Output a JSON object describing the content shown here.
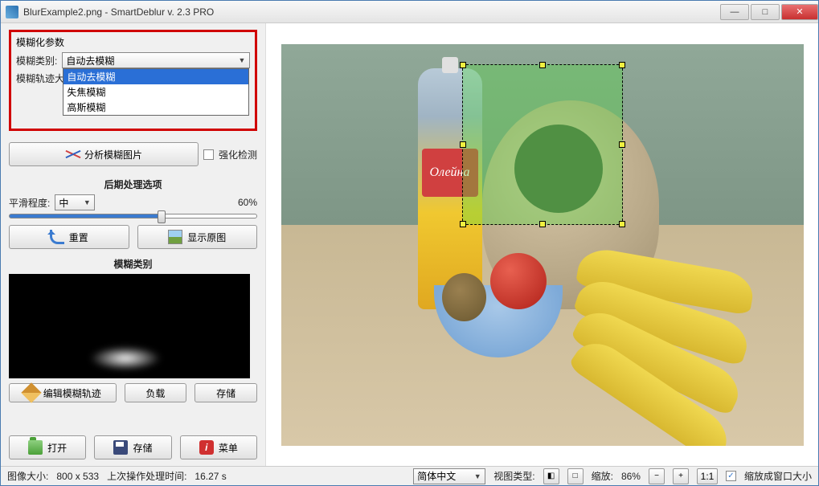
{
  "window": {
    "title": "BlurExample2.png - SmartDeblur v. 2.3 PRO"
  },
  "panel": {
    "blur_params_title": "模糊化参数",
    "blur_type_label": "模糊类别:",
    "blur_type_selected": "自动去模糊",
    "blur_type_options": [
      "自动去模糊",
      "失焦模糊",
      "高斯模糊"
    ],
    "blur_trace_label": "模糊轨迹大小:",
    "analyze_btn": "分析模糊图片",
    "enhance_detect": "强化检测",
    "post_title": "后期处理选项",
    "smooth_label": "平滑程度:",
    "smooth_level": "中",
    "smooth_percent": "60%",
    "reset_btn": "重置",
    "show_original_btn": "显示原图",
    "kernel_title": "模糊类别",
    "edit_kernel_btn": "编辑模糊轨迹",
    "load_btn": "负载",
    "save_kernel_btn": "存储",
    "open_btn": "打开",
    "save_btn": "存储",
    "menu_btn": "菜单"
  },
  "image": {
    "bottle_label": "Олейна"
  },
  "status": {
    "image_size_label": "图像大小:",
    "image_size": "800 x 533",
    "last_op_label": "上次操作处理时间:",
    "last_op_time": "16.27 s",
    "lang_label": "简体中文",
    "view_type_label": "视图类型:",
    "zoom_label": "缩放:",
    "zoom_value": "86%",
    "one_to_one": "1:1",
    "fit_window": "缩放成窗口大小"
  }
}
